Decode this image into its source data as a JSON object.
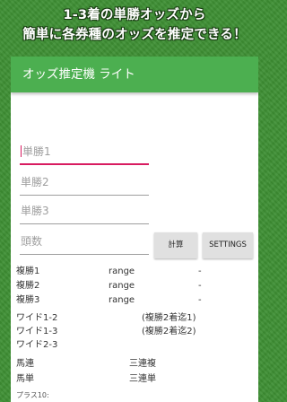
{
  "banner": {
    "line1": "1-3着の単勝オッズから",
    "line2": "簡単に各券種のオッズを推定できる！"
  },
  "app": {
    "title": "オッズ推定機 ライト"
  },
  "inputs": {
    "win1_placeholder": "単勝1",
    "win2_placeholder": "単勝2",
    "win3_placeholder": "単勝3",
    "heads_placeholder": "頭数"
  },
  "buttons": {
    "calc": "計算",
    "settings": "SETTINGS"
  },
  "results": {
    "place_rows": [
      {
        "label": "複勝1",
        "range": "range",
        "value": "-"
      },
      {
        "label": "複勝2",
        "range": "range",
        "value": "-"
      },
      {
        "label": "複勝3",
        "range": "range",
        "value": "-"
      }
    ],
    "wide_rows": [
      {
        "label": "ワイド1-2",
        "note": "(複勝2着迄1)"
      },
      {
        "label": "ワイド1-3",
        "note": "(複勝2着迄2)"
      },
      {
        "label": "ワイド2-3",
        "note": ""
      }
    ],
    "combo_rows": [
      {
        "left": "馬連",
        "right": "三連複"
      },
      {
        "left": "馬単",
        "right": "三連単"
      }
    ],
    "footer": "プラス10:"
  }
}
